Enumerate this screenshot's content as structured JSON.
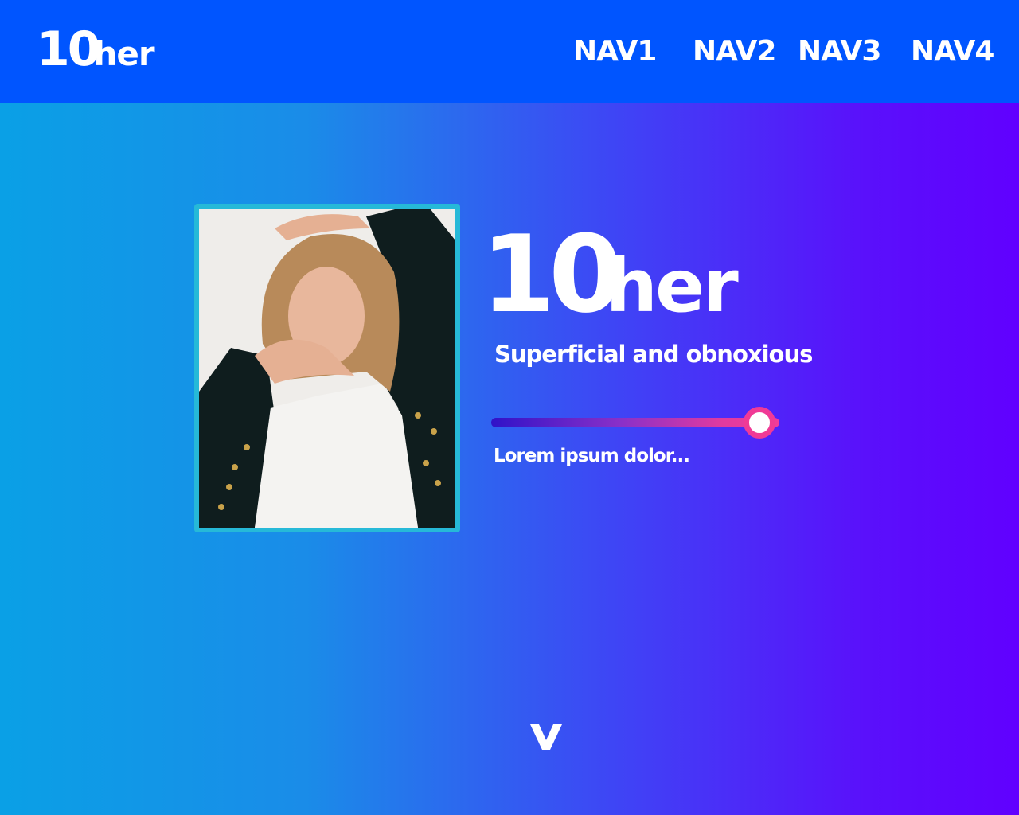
{
  "header": {
    "logo": {
      "primary": "10",
      "secondary": "her"
    },
    "nav": [
      {
        "label": "NAV1"
      },
      {
        "label": "NAV2"
      },
      {
        "label": "NAV3"
      },
      {
        "label": "NAV4"
      }
    ],
    "background_color": "#0055ff"
  },
  "hero": {
    "photo_alt": "woman-in-black-jacket-photo",
    "title": {
      "primary": "10",
      "secondary": "her"
    },
    "tagline": "Superficial and obnoxious",
    "slider": {
      "value_fraction": 0.93
    },
    "caption": "Lorem ipsum dolor..."
  },
  "scroll_icon": "chevron-down-icon",
  "colors": {
    "gradient_start": "#0aa0e6",
    "gradient_end": "#6100ff",
    "frame_border": "#26b9d8",
    "slider_accent": "#f03a96"
  }
}
